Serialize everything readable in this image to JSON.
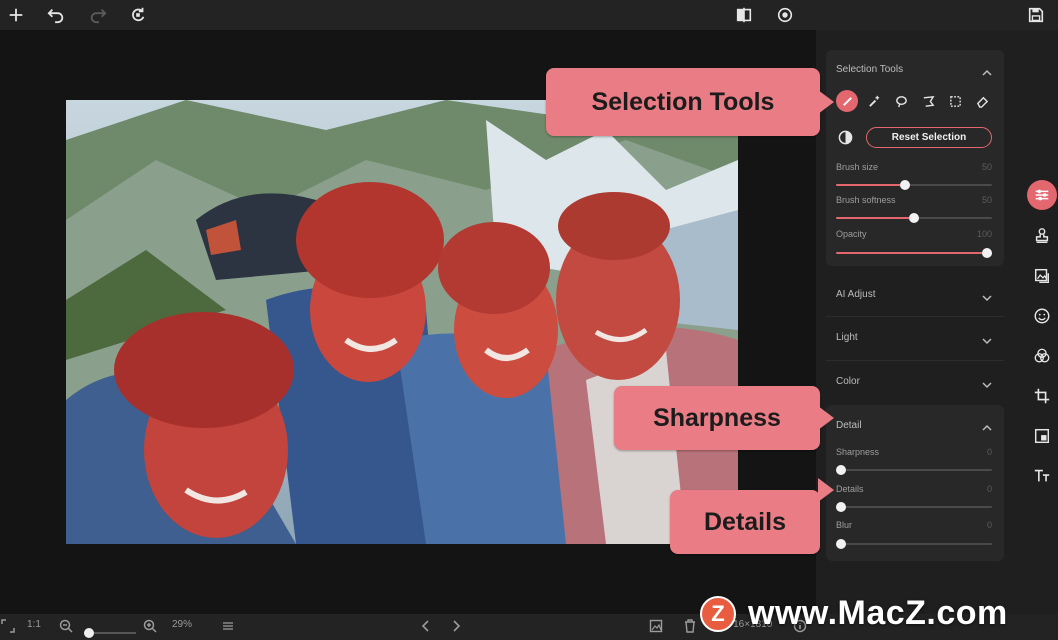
{
  "app": {
    "accent_color": "#e3676f"
  },
  "toolbar": {
    "items": [
      {
        "name": "add-icon"
      },
      {
        "name": "undo-icon"
      },
      {
        "name": "redo-icon"
      },
      {
        "name": "reset-icon"
      },
      {
        "name": "compare-icon"
      },
      {
        "name": "preview-eye-icon"
      },
      {
        "name": "save-icon"
      }
    ]
  },
  "selection": {
    "title": "Selection Tools",
    "tools": [
      "brush-tool-icon",
      "magic-wand-icon",
      "lasso-icon",
      "polygon-lasso-icon",
      "rect-select-icon",
      "eraser-icon"
    ],
    "reset_label": "Reset Selection",
    "sliders": [
      {
        "label": "Brush size",
        "value": "50",
        "level": 0.44
      },
      {
        "label": "Brush softness",
        "value": "50",
        "level": 0.5
      },
      {
        "label": "Opacity",
        "value": "100",
        "level": 1.0
      }
    ]
  },
  "sections": [
    {
      "title": "AI Adjust"
    },
    {
      "title": "Light"
    },
    {
      "title": "Color"
    }
  ],
  "detail": {
    "title": "Detail",
    "sliders": [
      {
        "label": "Sharpness",
        "value": "0",
        "level": 0
      },
      {
        "label": "Details",
        "value": "0",
        "level": 0
      },
      {
        "label": "Blur",
        "value": "0",
        "level": 0
      }
    ]
  },
  "sidebar_icons": [
    "adjust-sliders-icon",
    "stamp-icon",
    "image-replace-icon",
    "face-icon",
    "color-circles-icon",
    "crop-icon",
    "frame-icon",
    "text-icon"
  ],
  "callouts": {
    "selection": "Selection Tools",
    "sharpness": "Sharpness",
    "details": "Details"
  },
  "bottombar": {
    "ratio": "1:1",
    "zoom": "29%",
    "dimensions": "2716×1810"
  },
  "watermark": {
    "logo": "Z",
    "text": "www.MacZ.com"
  }
}
